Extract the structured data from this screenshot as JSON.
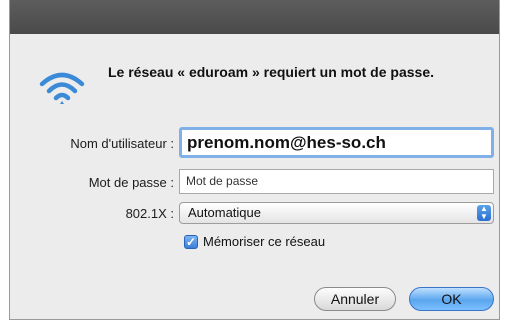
{
  "dialog": {
    "message": "Le réseau « eduroam » requiert un mot de passe."
  },
  "form": {
    "username_label": "Nom d'utilisateur :",
    "username_value": "prenom.nom@hes-so.ch",
    "password_label": "Mot de passe :",
    "password_placeholder": "Mot de passe",
    "auth_label": "802.1X :",
    "auth_value": "Automatique",
    "remember_label": "Mémoriser ce réseau",
    "remember_checked": true
  },
  "buttons": {
    "cancel_label": "Annuler",
    "ok_label": "OK"
  },
  "icons": {
    "network": "wifi-icon",
    "stepper": "updown-arrows-icon",
    "checkbox": "checkmark-icon"
  },
  "colors": {
    "wifi": "#3b8ad8",
    "accent": "#5aa6ee"
  }
}
